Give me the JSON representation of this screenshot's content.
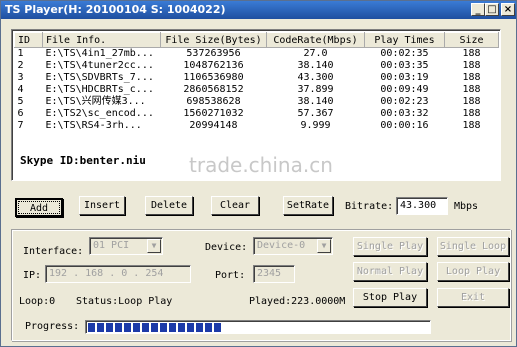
{
  "titlebar": {
    "title": "TS Player(H: 20100104 S: 1004022)",
    "minimize": "_",
    "maximize": "□",
    "close": "×"
  },
  "table": {
    "headers": [
      "ID",
      "File Info.",
      "File Size(Bytes)",
      "CodeRate(Mbps)",
      "Play Times",
      "Size"
    ],
    "rows": [
      [
        "1",
        "E:\\TS\\4in1_27mb...",
        "537263956",
        "27.0",
        "00:02:35",
        "188"
      ],
      [
        "2",
        "E:\\TS\\4tuner2cc...",
        "1048762136",
        "38.140",
        "00:03:35",
        "188"
      ],
      [
        "3",
        "E:\\TS\\SDVBRTs_7...",
        "1106536980",
        "43.300",
        "00:03:19",
        "188"
      ],
      [
        "4",
        "E:\\TS\\HDCBRTs_c...",
        "2860568152",
        "37.899",
        "00:09:49",
        "188"
      ],
      [
        "5",
        "E:\\TS\\兴网传媒3...",
        "698538628",
        "38.140",
        "00:02:23",
        "188"
      ],
      [
        "6",
        "E:\\TS2\\sc_encod...",
        "1560271032",
        "57.367",
        "00:03:32",
        "188"
      ],
      [
        "7",
        "E:\\TS\\RS4-3rh...",
        "20994148",
        "9.999",
        "00:00:16",
        "188"
      ]
    ]
  },
  "watermark": {
    "overlay": "Skype ID:benter.niu",
    "logo": "trade.china.cn"
  },
  "toolbar": {
    "add": "Add",
    "insert": "Insert",
    "delete": "Delete",
    "clear": "Clear",
    "setrate": "SetRate",
    "bitrate_label": "Bitrate:",
    "bitrate_value": "43.300",
    "bitrate_unit": "Mbps"
  },
  "settings": {
    "interface_label": "Interface:",
    "interface_value": "01 PCI",
    "device_label": "Device:",
    "device_value": "Device-0",
    "ip_label": "IP:",
    "ip_value": "192 . 168 . 0 . 254",
    "port_label": "Port:",
    "port_value": "2345"
  },
  "play": {
    "single_play": "Single Play",
    "single_loop": "Single Loop",
    "normal_play": "Normal Play",
    "loop_play": "Loop Play",
    "stop_play": "Stop Play",
    "exit": "Exit"
  },
  "status": {
    "loop": "Loop:0",
    "status": "Status:Loop Play",
    "played": "Played:223.0000M",
    "progress_label": "Progress:",
    "progress_fraction": 0.39
  }
}
